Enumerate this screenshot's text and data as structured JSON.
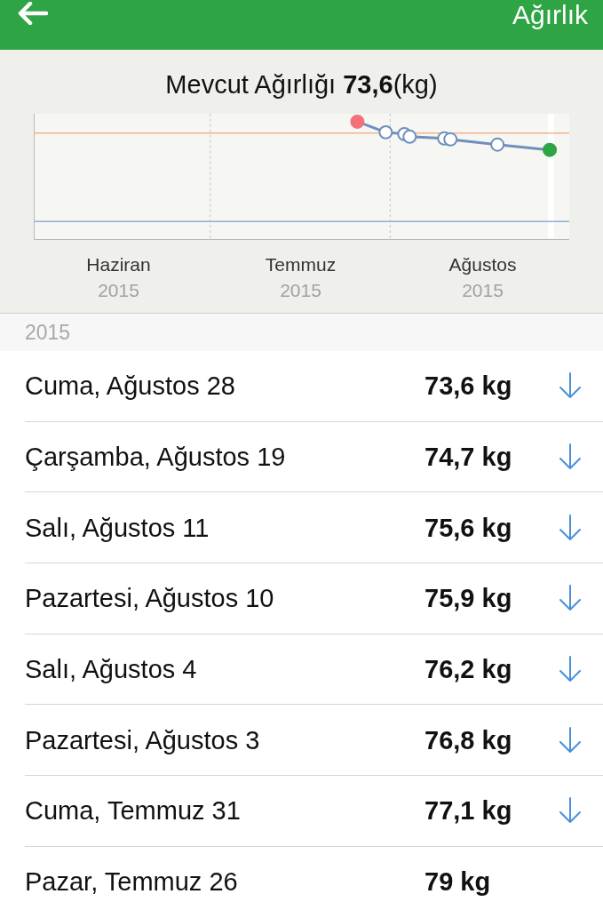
{
  "header": {
    "title": "Ağırlık"
  },
  "summary": {
    "title": "Mevcut Ağırlığı **73,6**(kg)"
  },
  "chart": {
    "x_labels": [
      {
        "month": "Haziran",
        "year": "2015"
      },
      {
        "month": "Temmuz",
        "year": "2015"
      },
      {
        "month": "Ağustos",
        "year": "2015"
      }
    ]
  },
  "section": {
    "title": "2015"
  },
  "entries": [
    {
      "date": "Cuma, Ağustos 28",
      "weight": "73,6 kg",
      "decreased": true
    },
    {
      "date": "Çarşamba, Ağustos 19",
      "weight": "74,7 kg",
      "decreased": true
    },
    {
      "date": "Salı, Ağustos 11",
      "weight": "75,6 kg",
      "decreased": true
    },
    {
      "date": "Pazartesi, Ağustos 10",
      "weight": "75,9 kg",
      "decreased": true
    },
    {
      "date": "Salı, Ağustos 4",
      "weight": "76,2 kg",
      "decreased": true
    },
    {
      "date": "Pazartesi, Ağustos 3",
      "weight": "76,8 kg",
      "decreased": true
    },
    {
      "date": "Cuma, Temmuz 31",
      "weight": "77,1 kg",
      "decreased": true
    },
    {
      "date": "Pazar, Temmuz 26",
      "weight": "79 kg",
      "decreased": false
    }
  ]
}
